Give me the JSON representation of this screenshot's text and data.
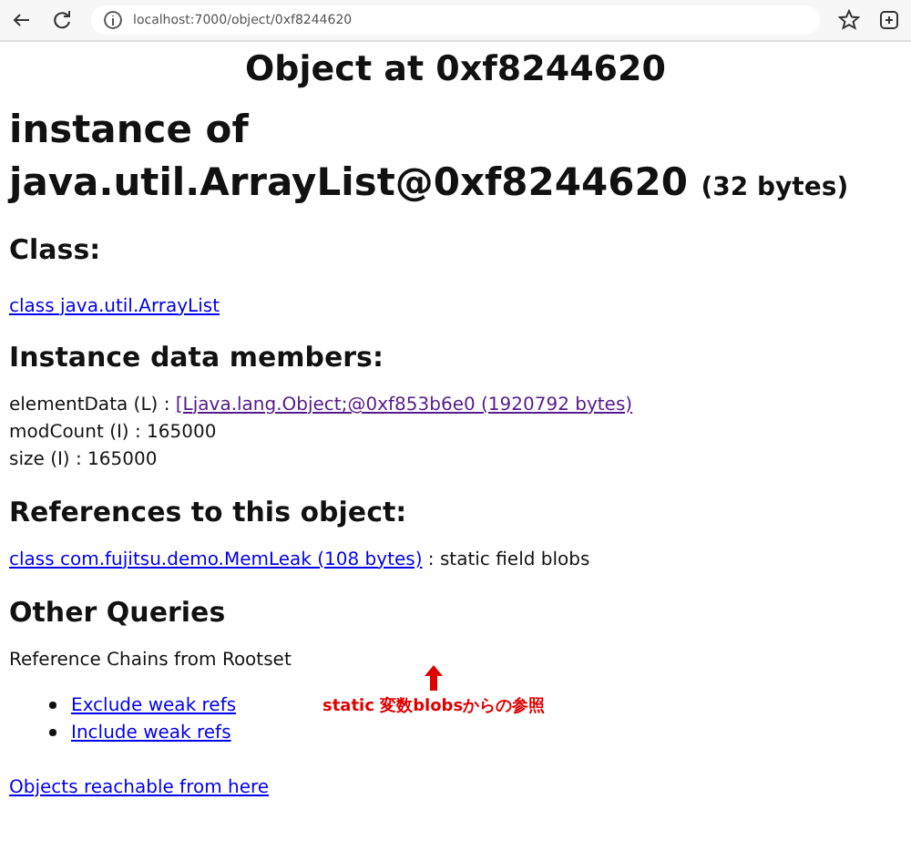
{
  "browser": {
    "url": "localhost:7000/object/0xf8244620"
  },
  "page_title": "Object at 0xf8244620",
  "heading": "instance of java.util.ArrayList@0xf8244620",
  "heading_size": "(32 bytes)",
  "class_section": {
    "title": "Class:",
    "link": "class java.util.ArrayList"
  },
  "members_section": {
    "title": "Instance data members:",
    "members": [
      {
        "label": "elementData (L) : ",
        "link": "[Ljava.lang.Object;@0xf853b6e0 (1920792 bytes)",
        "visited": true
      },
      {
        "label": "modCount (I) : 165000"
      },
      {
        "label": "size (I) : 165000"
      }
    ]
  },
  "references_section": {
    "title": "References to this object:",
    "link": "class com.fujitsu.demo.MemLeak (108 bytes)",
    "suffix": " : static field blobs"
  },
  "annotation": "static 変数blobsからの参照",
  "queries_section": {
    "title": "Other Queries",
    "subtitle": "Reference Chains from Rootset",
    "links": [
      "Exclude weak refs",
      "Include weak refs"
    ],
    "footer_link": "Objects reachable from here"
  }
}
